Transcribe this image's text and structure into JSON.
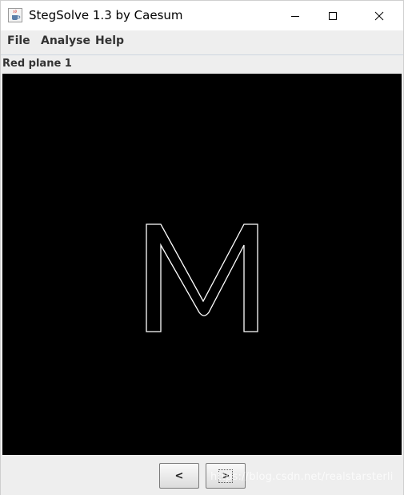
{
  "window": {
    "title": "StegSolve 1.3 by Caesum",
    "app_icon": "java-cup-icon",
    "controls": [
      "minimize-icon",
      "maximize-icon",
      "close-icon"
    ]
  },
  "menu": {
    "items": [
      "File",
      "Analyse",
      "Help"
    ]
  },
  "view": {
    "plane_label": "Red plane 1",
    "image_content": "M"
  },
  "navigation": {
    "prev_label": "<",
    "next_label": ">"
  },
  "watermark": {
    "text": "https://blog.csdn.net/realstarsterli"
  },
  "colors": {
    "canvas_bg": "#000000",
    "outline": "#ffffff",
    "label_text": "#333333"
  }
}
